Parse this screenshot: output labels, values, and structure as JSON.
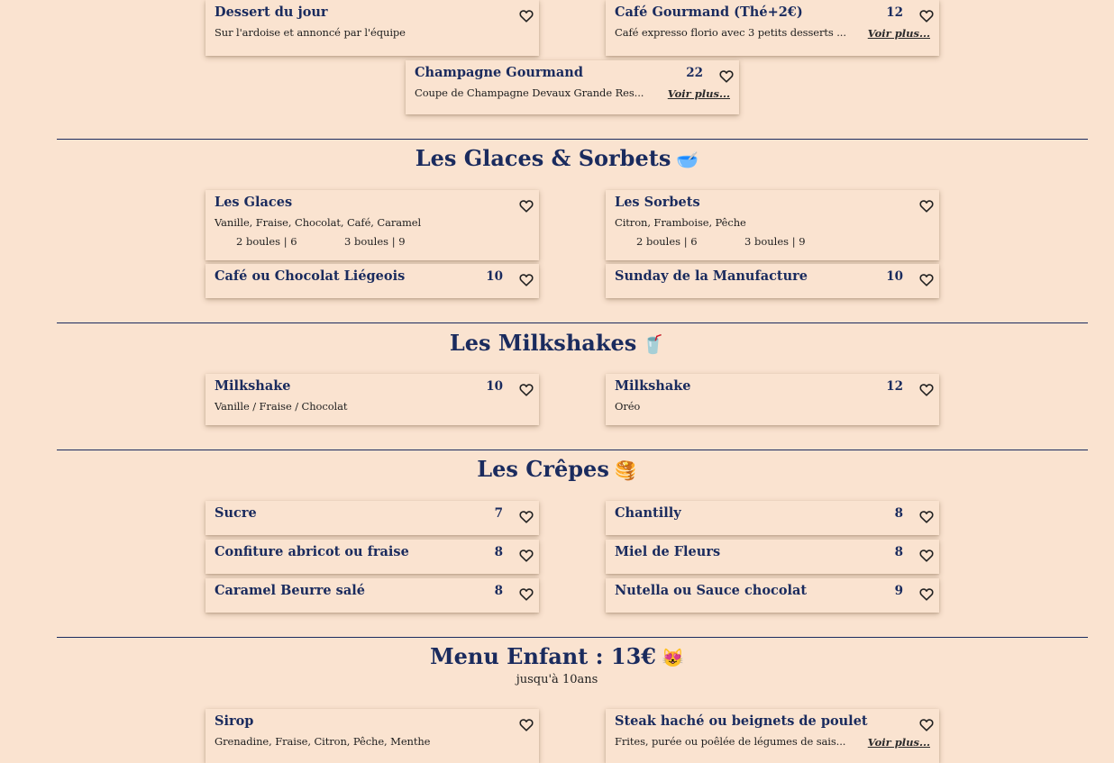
{
  "cards": {
    "dessert_jour": {
      "name": "Dessert du jour",
      "desc": "Sur l'ardoise et annoncé par l'équipe"
    },
    "cafe_gourmand": {
      "name": "Café Gourmand (Thé+2€)",
      "price": "12",
      "desc": "Café expresso florio avec 3 petits desserts ...",
      "more": "Voir plus..."
    },
    "champagne_gourmand": {
      "name": "Champagne Gourmand",
      "price": "22",
      "desc": "Coupe de Champagne Devaux Grande Res...",
      "more": "Voir plus..."
    }
  },
  "sections": {
    "glaces": {
      "title": "Les Glaces & Sorbets",
      "emoji": "🥣",
      "glaces": {
        "name": "Les Glaces",
        "desc": "Vanille, Fraise, Chocolat, Café, Caramel",
        "size1": "2 boules | 6",
        "size2": "3 boules | 9"
      },
      "sorbets": {
        "name": "Les Sorbets",
        "desc": "Citron, Framboise, Pêche",
        "size1": "2 boules | 6",
        "size2": "3 boules | 9"
      },
      "liegeois": {
        "name": "Café ou Chocolat Liégeois",
        "price": "10"
      },
      "sunday": {
        "name": "Sunday de la Manufacture",
        "price": "10"
      }
    },
    "milkshakes": {
      "title": "Les Milkshakes",
      "emoji": "🥤",
      "milkshake1": {
        "name": "Milkshake",
        "price": "10",
        "desc": "Vanille / Fraise / Chocolat"
      },
      "milkshake2": {
        "name": "Milkshake",
        "price": "12",
        "desc": "Oréo"
      }
    },
    "crepes": {
      "title": "Les Crêpes",
      "emoji": "🥞",
      "sucre": {
        "name": "Sucre",
        "price": "7"
      },
      "chantilly": {
        "name": "Chantilly",
        "price": "8"
      },
      "confiture": {
        "name": "Confiture abricot ou fraise",
        "price": "8"
      },
      "miel": {
        "name": "Miel de Fleurs",
        "price": "8"
      },
      "caramel": {
        "name": "Caramel Beurre salé",
        "price": "8"
      },
      "nutella": {
        "name": "Nutella ou Sauce chocolat",
        "price": "9"
      }
    },
    "enfant": {
      "title": "Menu Enfant : 13€",
      "emoji": "😻",
      "subtitle": "jusqu'à 10ans",
      "sirop": {
        "name": "Sirop",
        "desc": "Grenadine, Fraise, Citron, Pêche, Menthe"
      },
      "steak": {
        "name": "Steak haché ou beignets de poulet",
        "desc": "Frites, purée ou poêlée de légumes de sais...",
        "more": "Voir plus..."
      }
    }
  },
  "colors": {
    "background": "#fae3d0",
    "title": "#1a2b5e",
    "text": "#1f1f1f",
    "heart": "#222222"
  },
  "icons": {
    "favorite": "heart-outline-icon"
  }
}
